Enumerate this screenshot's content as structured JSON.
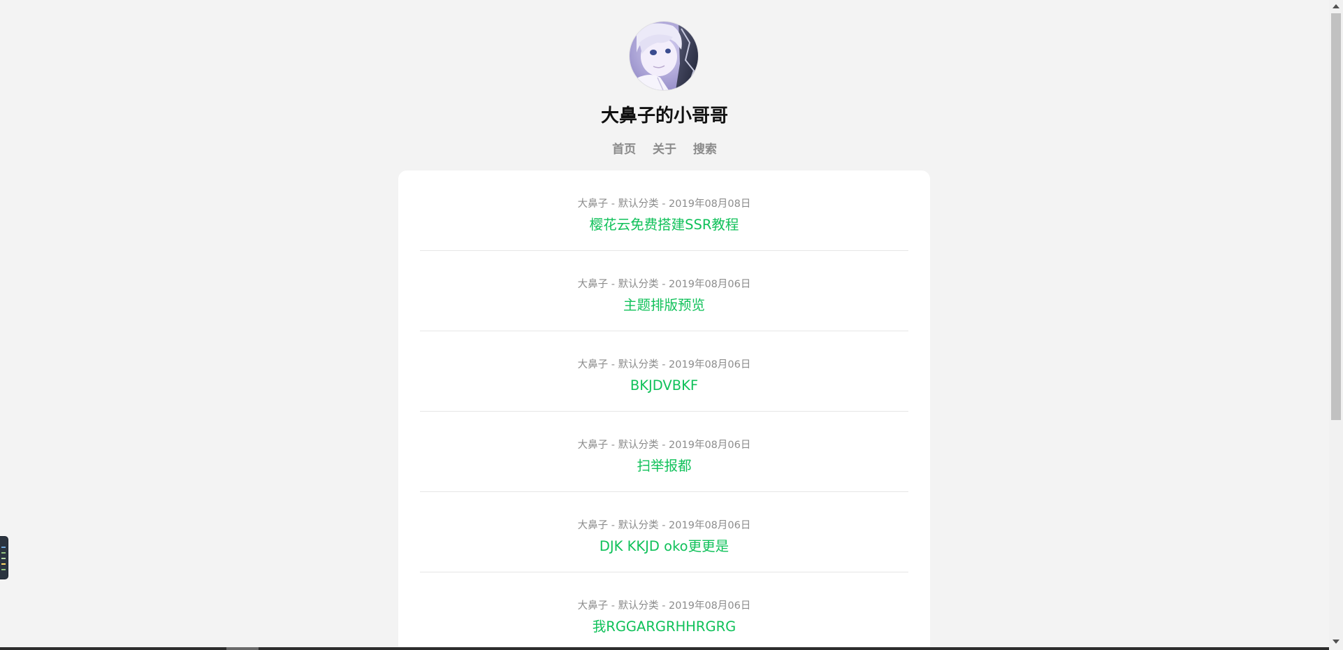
{
  "site": {
    "title": "大鼻子的小哥哥",
    "nav": [
      "首页",
      "关于",
      "搜索"
    ]
  },
  "posts": [
    {
      "meta": "大鼻子 - 默认分类 - 2019年08月08日",
      "title": "樱花云免费搭建SSR教程"
    },
    {
      "meta": "大鼻子 - 默认分类 - 2019年08月06日",
      "title": "主题排版预览"
    },
    {
      "meta": "大鼻子 - 默认分类 - 2019年08月06日",
      "title": "BKJDVBKF"
    },
    {
      "meta": "大鼻子 - 默认分类 - 2019年08月06日",
      "title": "扫举报都"
    },
    {
      "meta": "大鼻子 - 默认分类 - 2019年08月06日",
      "title": "DJK KKJD oko更更是"
    },
    {
      "meta": "大鼻子 - 默认分类 - 2019年08月06日",
      "title": "我RGGARGRHHRGRG"
    }
  ],
  "colors": {
    "background": "#f3f3f3",
    "card": "#ffffff",
    "post_title": "#10c15a",
    "meta": "#8c8c8c",
    "nav": "#8a8a8a"
  }
}
